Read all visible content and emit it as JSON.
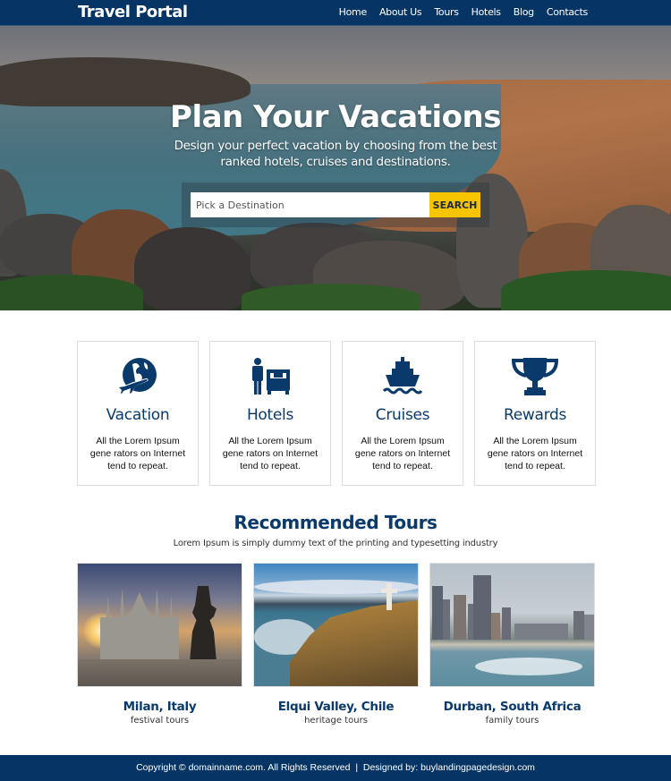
{
  "nav": {
    "brand": "Travel Portal",
    "items": [
      {
        "label": "Home"
      },
      {
        "label": "About Us"
      },
      {
        "label": "Tours"
      },
      {
        "label": "Hotels"
      },
      {
        "label": "Blog"
      },
      {
        "label": "Contacts"
      }
    ]
  },
  "hero": {
    "title": "Plan Your Vacations",
    "subtitle": "Design your perfect vacation by choosing from the best ranked hotels, cruises and destinations.",
    "search_placeholder": "Pick a Destination",
    "search_value": "",
    "search_button": "SEARCH"
  },
  "features": [
    {
      "icon": "globe-plane-icon",
      "title": "Vacation",
      "desc": "All the Lorem Ipsum gene rators on Internet tend to repeat."
    },
    {
      "icon": "hotel-bed-icon",
      "title": "Hotels",
      "desc": "All the Lorem Ipsum gene rators on Internet tend to repeat."
    },
    {
      "icon": "ship-icon",
      "title": "Cruises",
      "desc": "All the Lorem Ipsum gene rators on Internet tend to repeat."
    },
    {
      "icon": "trophy-icon",
      "title": "Rewards",
      "desc": "All the Lorem Ipsum gene rators on Internet tend to repeat."
    }
  ],
  "tours": {
    "title": "Recommended Tours",
    "subtitle": "Lorem Ipsum is simply dummy text of the printing and typesetting industry",
    "items": [
      {
        "name": "Milan, Italy",
        "kind": "festival tours"
      },
      {
        "name": "Elqui Valley, Chile",
        "kind": "heritage tours"
      },
      {
        "name": "Durban, South Africa",
        "kind": "family tours"
      }
    ]
  },
  "footer": {
    "text": "Copyright © domainname.com. All Rights Reserved  |  Designed by: buylandingpagedesign.com"
  },
  "colors": {
    "primary": "#063565",
    "accent": "#f7c400",
    "heading": "#0a3a6b"
  }
}
